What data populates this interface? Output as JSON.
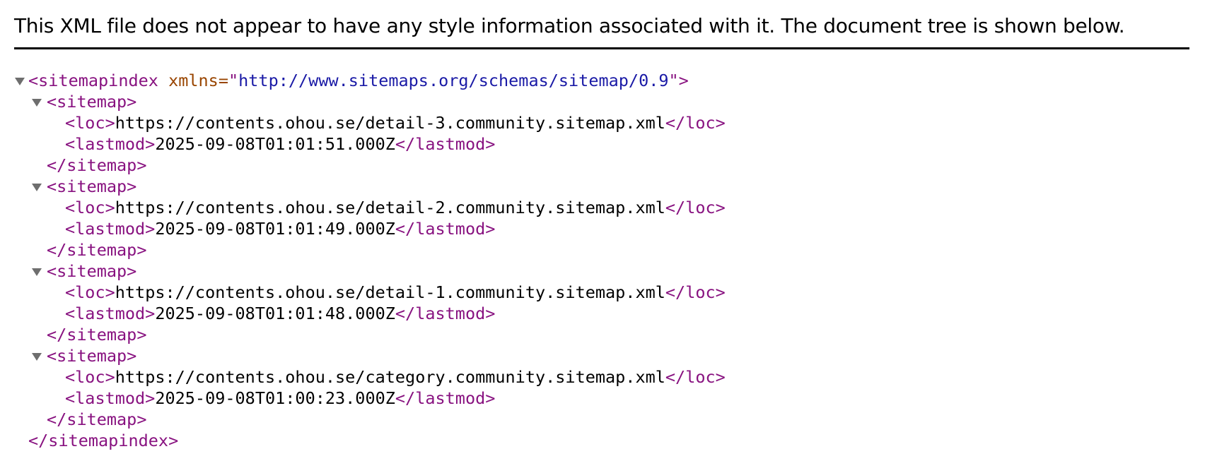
{
  "info": {
    "message": "This XML file does not appear to have any style information associated with it. The document tree is shown below."
  },
  "root": {
    "open_tag": "<sitemapindex",
    "attr_name": " xmlns=",
    "quote_open": "\"",
    "attr_value": "http://www.sitemaps.org/schemas/sitemap/0.9",
    "quote_close_gt": "\">",
    "close_tag": "</sitemapindex>"
  },
  "tags": {
    "sitemap_open": "<sitemap>",
    "sitemap_close": "</sitemap>",
    "loc_open": "<loc>",
    "loc_close": "</loc>",
    "lastmod_open": "<lastmod>",
    "lastmod_close": "</lastmod>"
  },
  "sitemaps": [
    {
      "loc": "https://contents.ohou.se/detail-3.community.sitemap.xml",
      "lastmod": "2025-09-08T01:01:51.000Z"
    },
    {
      "loc": "https://contents.ohou.se/detail-2.community.sitemap.xml",
      "lastmod": "2025-09-08T01:01:49.000Z"
    },
    {
      "loc": "https://contents.ohou.se/detail-1.community.sitemap.xml",
      "lastmod": "2025-09-08T01:01:48.000Z"
    },
    {
      "loc": "https://contents.ohou.se/category.community.sitemap.xml",
      "lastmod": "2025-09-08T01:00:23.000Z"
    }
  ],
  "colors": {
    "tag": "#881280",
    "attr_name": "#994500",
    "attr_value": "#1a1aa6",
    "text": "#000000",
    "toggle": "#6e6e6e"
  }
}
